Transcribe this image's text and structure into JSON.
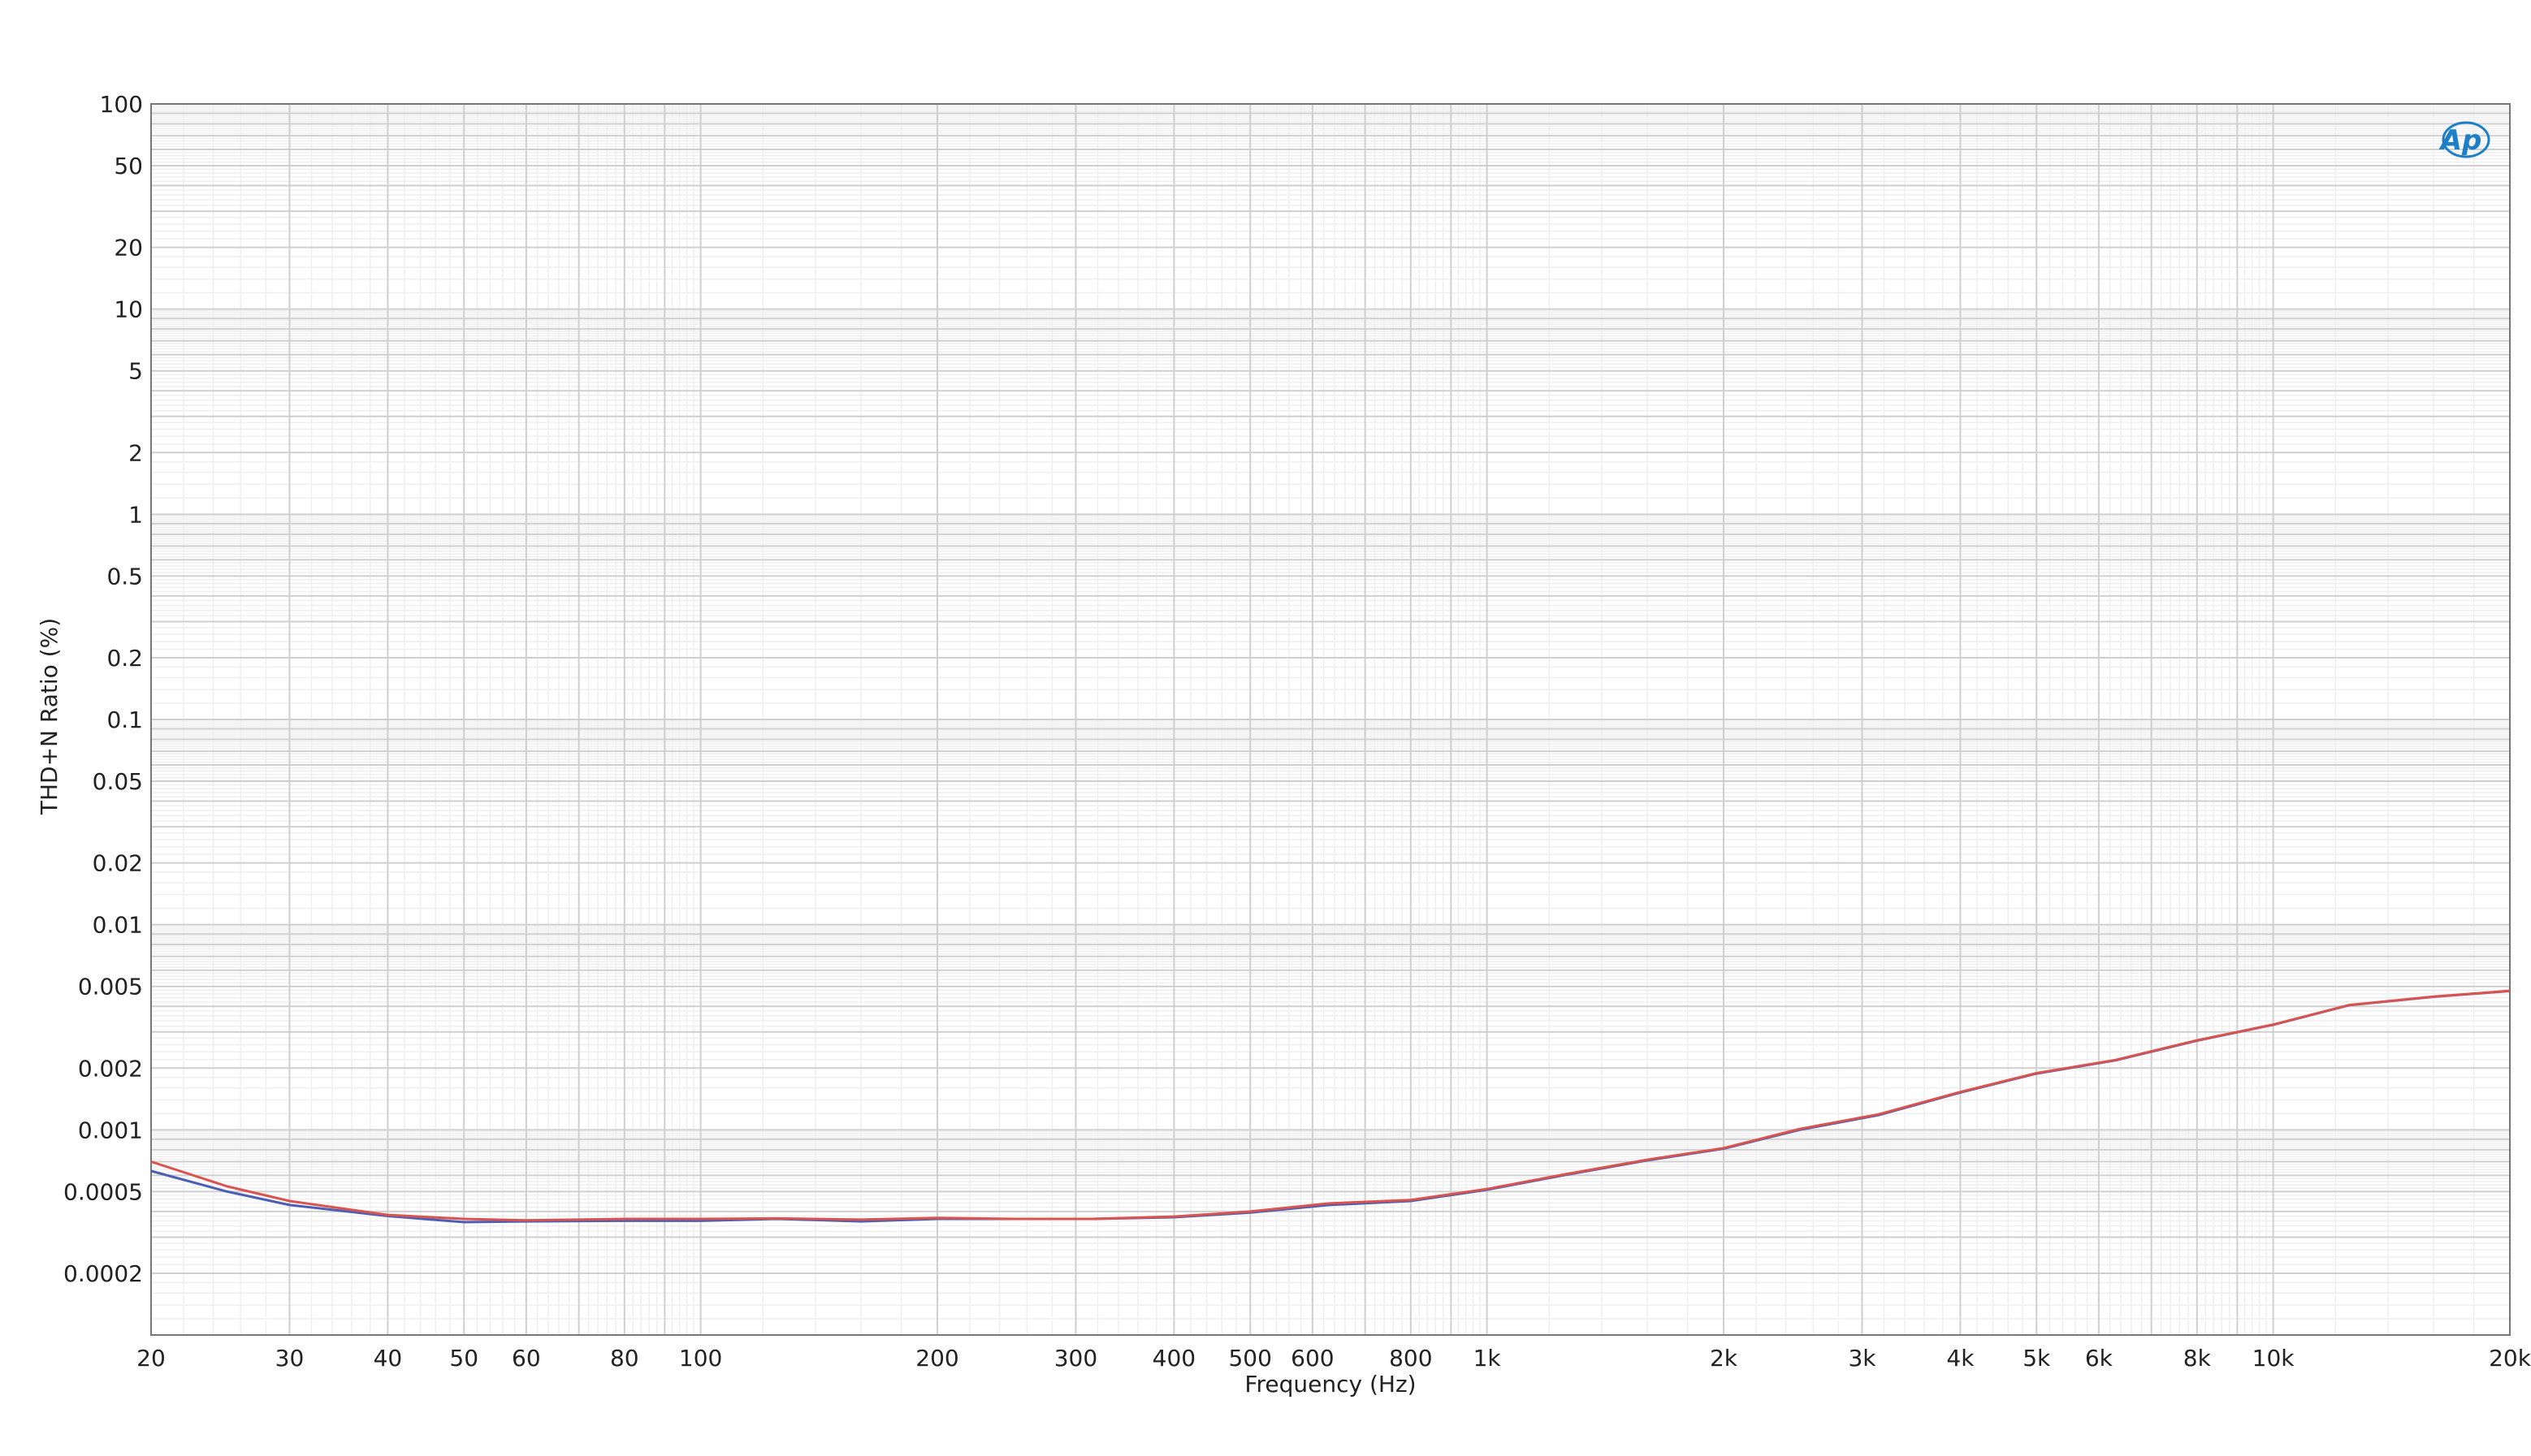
{
  "chart_data": {
    "type": "line",
    "title": "",
    "xlabel": "Frequency (Hz)",
    "ylabel": "THD+N Ratio (%)",
    "x_scale": "log",
    "y_scale": "log",
    "xlim": [
      20,
      20000
    ],
    "ylim": [
      0.0001,
      100
    ],
    "grid": true,
    "legend": "none",
    "x_ticks": [
      {
        "value": 20,
        "label": "20"
      },
      {
        "value": 30,
        "label": "30"
      },
      {
        "value": 40,
        "label": "40"
      },
      {
        "value": 50,
        "label": "50"
      },
      {
        "value": 60,
        "label": "60"
      },
      {
        "value": 80,
        "label": "80"
      },
      {
        "value": 100,
        "label": "100"
      },
      {
        "value": 200,
        "label": "200"
      },
      {
        "value": 300,
        "label": "300"
      },
      {
        "value": 400,
        "label": "400"
      },
      {
        "value": 500,
        "label": "500"
      },
      {
        "value": 600,
        "label": "600"
      },
      {
        "value": 800,
        "label": "800"
      },
      {
        "value": 1000,
        "label": "1k"
      },
      {
        "value": 2000,
        "label": "2k"
      },
      {
        "value": 3000,
        "label": "3k"
      },
      {
        "value": 4000,
        "label": "4k"
      },
      {
        "value": 5000,
        "label": "5k"
      },
      {
        "value": 6000,
        "label": "6k"
      },
      {
        "value": 8000,
        "label": "8k"
      },
      {
        "value": 10000,
        "label": "10k"
      },
      {
        "value": 20000,
        "label": "20k"
      }
    ],
    "y_ticks": [
      {
        "value": 100,
        "label": "100"
      },
      {
        "value": 50,
        "label": "50"
      },
      {
        "value": 20,
        "label": "20"
      },
      {
        "value": 10,
        "label": "10"
      },
      {
        "value": 5,
        "label": "5"
      },
      {
        "value": 2,
        "label": "2"
      },
      {
        "value": 1,
        "label": "1"
      },
      {
        "value": 0.5,
        "label": "0.5"
      },
      {
        "value": 0.2,
        "label": "0.2"
      },
      {
        "value": 0.1,
        "label": "0.1"
      },
      {
        "value": 0.05,
        "label": "0.05"
      },
      {
        "value": 0.02,
        "label": "0.02"
      },
      {
        "value": 0.01,
        "label": "0.01"
      },
      {
        "value": 0.005,
        "label": "0.005"
      },
      {
        "value": 0.002,
        "label": "0.002"
      },
      {
        "value": 0.001,
        "label": "0.001"
      },
      {
        "value": 0.0005,
        "label": "0.0005"
      },
      {
        "value": 0.0002,
        "label": "0.0002"
      }
    ],
    "series": [
      {
        "color": "#4a5fb5",
        "x": [
          20,
          25,
          30,
          40,
          50,
          60,
          80,
          100,
          125,
          160,
          200,
          250,
          315,
          400,
          500,
          630,
          800,
          1000,
          1250,
          1600,
          2000,
          2500,
          3150,
          4000,
          5000,
          6300,
          8000,
          10000,
          12500,
          16000,
          20000
        ],
        "y": [
          0.00063,
          0.0005,
          0.00043,
          0.00038,
          0.000355,
          0.000358,
          0.00036,
          0.00036,
          0.000368,
          0.000358,
          0.000368,
          0.000368,
          0.000368,
          0.000375,
          0.000395,
          0.00043,
          0.00045,
          0.00051,
          0.0006,
          0.00071,
          0.00081,
          0.001,
          0.00118,
          0.00152,
          0.00188,
          0.00218,
          0.00272,
          0.00325,
          0.00405,
          0.00445,
          0.00475
        ]
      },
      {
        "color": "#d9534f",
        "x": [
          20,
          25,
          30,
          40,
          50,
          60,
          80,
          100,
          125,
          160,
          200,
          250,
          315,
          400,
          500,
          630,
          800,
          1000,
          1250,
          1600,
          2000,
          2500,
          3150,
          4000,
          5000,
          6300,
          8000,
          10000,
          12500,
          16000,
          20000
        ],
        "y": [
          0.0007,
          0.00053,
          0.00045,
          0.000385,
          0.000368,
          0.000362,
          0.000368,
          0.000368,
          0.00037,
          0.000365,
          0.000372,
          0.000368,
          0.000368,
          0.000378,
          0.0004,
          0.000438,
          0.000455,
          0.000515,
          0.000605,
          0.000715,
          0.000815,
          0.00101,
          0.00119,
          0.00153,
          0.00189,
          0.00219,
          0.00273,
          0.00326,
          0.00406,
          0.00446,
          0.00476
        ]
      }
    ]
  },
  "logo": {
    "text": "Ap",
    "color": "#1d7fc6"
  }
}
